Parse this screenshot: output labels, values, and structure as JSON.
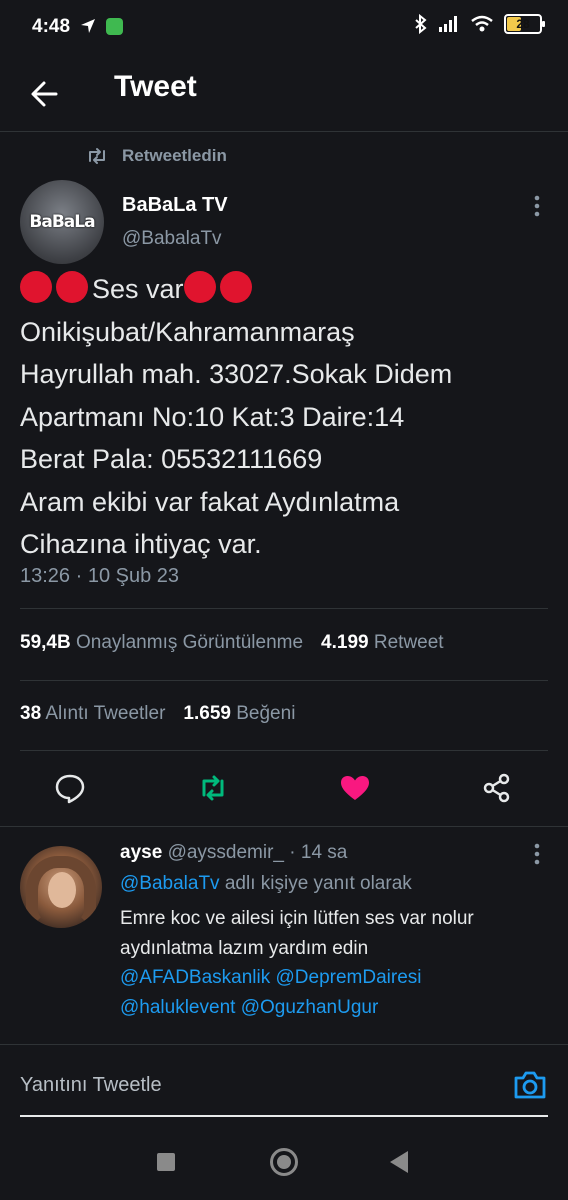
{
  "status_bar": {
    "time": "4:48",
    "battery": "28"
  },
  "header": {
    "title": "Tweet"
  },
  "retweet": {
    "label": "Retweetledin"
  },
  "tweet": {
    "author_name": "BaBaLa TV",
    "author_handle": "@BabalaTv",
    "avatar_logo": "BaBaLa",
    "lines": {
      "l1": "Ses var",
      "l2": "Onikişubat/Kahramanmaraş",
      "l3": "Hayrullah mah. 33027.Sokak Didem",
      "l4": "Apartmanı No:10 Kat:3 Daire:14",
      "l5": "Berat Pala: 05532111669",
      "l6": "Aram ekibi var fakat Aydınlatma",
      "l7": "Cihazına ihtiyaç var."
    },
    "timestamp": "13:26 · 10 Şub 23"
  },
  "stats": {
    "views_count": "59,4B",
    "views_label": "Onaylanmış Görüntülenme",
    "retweets_count": "4.199",
    "retweets_label": "Retweet",
    "quotes_count": "38",
    "quotes_label": "Alıntı Tweetler",
    "likes_count": "1.659",
    "likes_label": "Beğeni"
  },
  "actions": {
    "reply_icon": "comment-icon",
    "retweet_icon": "retweet-icon",
    "like_icon": "heart-icon",
    "share_icon": "share-icon",
    "retweet_color": "#00ba7c",
    "like_color": "#f91880"
  },
  "reply": {
    "name": "ayse",
    "handle": "@ayssdemir_",
    "time": "· 14 sa",
    "reply_to_handle": "@BabalaTv",
    "reply_to_text": "adlı kişiye yanıt olarak",
    "line1": "Emre koc ve ailesi için lütfen ses var nolur",
    "line2": "aydınlatma lazım yardım edin",
    "mention1": "@AFADBaskanlik",
    "mention2": "@DepremDairesi",
    "mention3": "@haluklevent",
    "mention4": "@OguzhanUgur"
  },
  "compose": {
    "placeholder": "Yanıtını Tweetle"
  }
}
